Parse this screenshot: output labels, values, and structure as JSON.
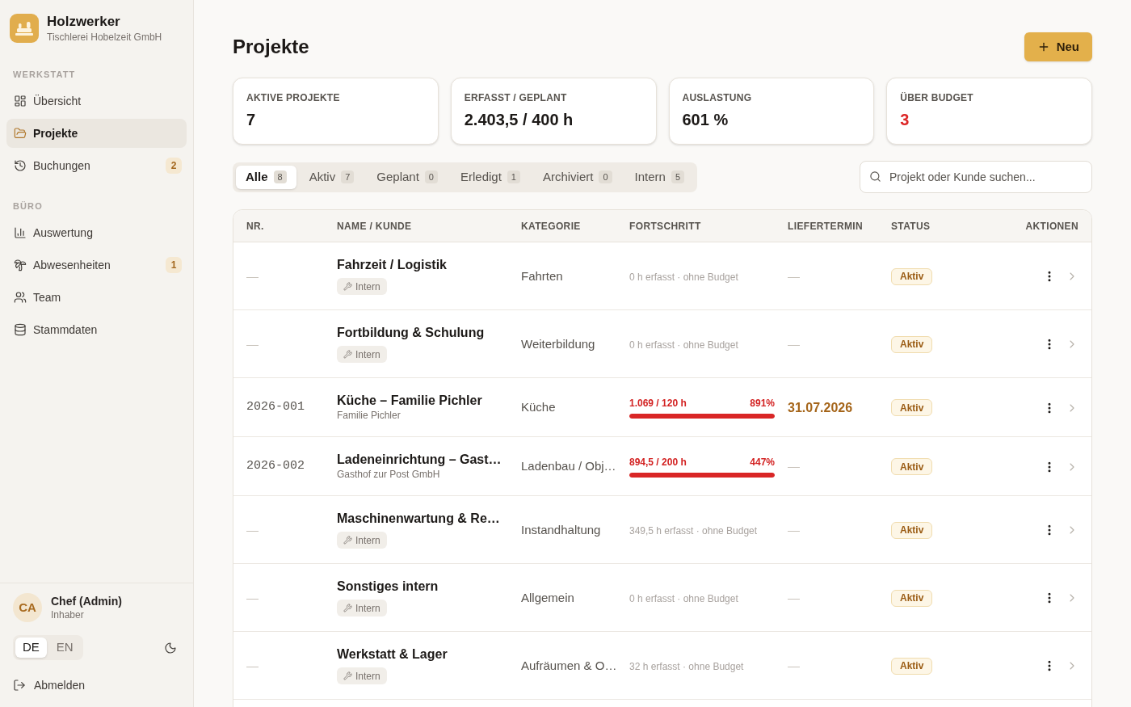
{
  "brand": {
    "name": "Holzwerker",
    "subtitle": "Tischlerei Hobelzeit GmbH"
  },
  "nav_sections": [
    {
      "label": "WERKSTATT",
      "items": [
        {
          "label": "Übersicht",
          "selected": false
        },
        {
          "label": "Projekte",
          "selected": true
        },
        {
          "label": "Buchungen",
          "selected": false,
          "badge": "2"
        }
      ]
    },
    {
      "label": "BÜRO",
      "items": [
        {
          "label": "Auswertung",
          "selected": false
        },
        {
          "label": "Abwesenheiten",
          "selected": false,
          "badge": "1"
        },
        {
          "label": "Team",
          "selected": false
        },
        {
          "label": "Stammdaten",
          "selected": false
        }
      ]
    }
  ],
  "user": {
    "initials": "CA",
    "name": "Chef (Admin)",
    "role": "Inhaber"
  },
  "languages": [
    {
      "label": "DE",
      "selected": true
    },
    {
      "label": "EN",
      "selected": false
    }
  ],
  "logout": "Abmelden",
  "page": {
    "title": "Projekte",
    "new_button": "Neu"
  },
  "stats": [
    {
      "label": "AKTIVE PROJEKTE",
      "value": "7",
      "alert": false
    },
    {
      "label": "ERFASST / GEPLANT",
      "value": "2.403,5 / 400 h",
      "alert": false
    },
    {
      "label": "AUSLASTUNG",
      "value": "601 %",
      "alert": false
    },
    {
      "label": "ÜBER BUDGET",
      "value": "3",
      "alert": true
    }
  ],
  "filter_tabs": [
    {
      "label": "Alle",
      "count": "8",
      "selected": true
    },
    {
      "label": "Aktiv",
      "count": "7",
      "selected": false
    },
    {
      "label": "Geplant",
      "count": "0",
      "selected": false
    },
    {
      "label": "Erledigt",
      "count": "1",
      "selected": false
    },
    {
      "label": "Archiviert",
      "count": "0",
      "selected": false
    },
    {
      "label": "Intern",
      "count": "5",
      "selected": false
    }
  ],
  "search": {
    "placeholder": "Projekt oder Kunde suchen..."
  },
  "table": {
    "columns": [
      "NR.",
      "NAME / KUNDE",
      "KATEGORIE",
      "FORTSCHRITT",
      "LIEFERTERMIN",
      "STATUS",
      "AKTIONEN"
    ],
    "rows": [
      {
        "nr": {
          "text": "—",
          "placeholder": true
        },
        "name": "Fahrzeit / Logistik",
        "sub": {
          "kind": "tag",
          "text": "Intern"
        },
        "category": "Fahrten",
        "progress": {
          "kind": "text",
          "text": "0 h erfasst · ohne Budget"
        },
        "deadline": {
          "text": "—",
          "emphasized": false
        },
        "status": "Aktiv"
      },
      {
        "nr": {
          "text": "—",
          "placeholder": true
        },
        "name": "Fortbildung & Schulung",
        "sub": {
          "kind": "tag",
          "text": "Intern"
        },
        "category": "Weiterbildung",
        "progress": {
          "kind": "text",
          "text": "0 h erfasst · ohne Budget"
        },
        "deadline": {
          "text": "—",
          "emphasized": false
        },
        "status": "Aktiv"
      },
      {
        "nr": {
          "text": "2026-001",
          "placeholder": false
        },
        "name": "Küche – Familie Pichler",
        "sub": {
          "kind": "client",
          "text": "Familie Pichler"
        },
        "category": "Küche",
        "progress": {
          "kind": "bar",
          "hours": "1.069 / 120 h",
          "percent": "891%",
          "level": 1,
          "over_budget": true
        },
        "deadline": {
          "text": "31.07.2026",
          "emphasized": true
        },
        "status": "Aktiv"
      },
      {
        "nr": {
          "text": "2026-002",
          "placeholder": false
        },
        "name": "Ladeneinrichtung – Gast…",
        "sub": {
          "kind": "client",
          "text": "Gasthof zur Post GmbH"
        },
        "category": "Ladenbau / Obj…",
        "progress": {
          "kind": "bar",
          "hours": "894,5 / 200 h",
          "percent": "447%",
          "level": 1,
          "over_budget": true
        },
        "deadline": {
          "text": "—",
          "emphasized": false
        },
        "status": "Aktiv"
      },
      {
        "nr": {
          "text": "—",
          "placeholder": true
        },
        "name": "Maschinenwartung & Re…",
        "sub": {
          "kind": "tag",
          "text": "Intern"
        },
        "category": "Instandhaltung",
        "progress": {
          "kind": "text",
          "text": "349,5 h erfasst · ohne Budget"
        },
        "deadline": {
          "text": "—",
          "emphasized": false
        },
        "status": "Aktiv"
      },
      {
        "nr": {
          "text": "—",
          "placeholder": true
        },
        "name": "Sonstiges intern",
        "sub": {
          "kind": "tag",
          "text": "Intern"
        },
        "category": "Allgemein",
        "progress": {
          "kind": "text",
          "text": "0 h erfasst · ohne Budget"
        },
        "deadline": {
          "text": "—",
          "emphasized": false
        },
        "status": "Aktiv"
      },
      {
        "nr": {
          "text": "—",
          "placeholder": true
        },
        "name": "Werkstatt & Lager",
        "sub": {
          "kind": "tag",
          "text": "Intern"
        },
        "category": "Aufräumen & O…",
        "progress": {
          "kind": "text",
          "text": "32 h erfasst · ohne Budget"
        },
        "deadline": {
          "text": "—",
          "emphasized": false
        },
        "status": "Aktiv"
      }
    ]
  }
}
